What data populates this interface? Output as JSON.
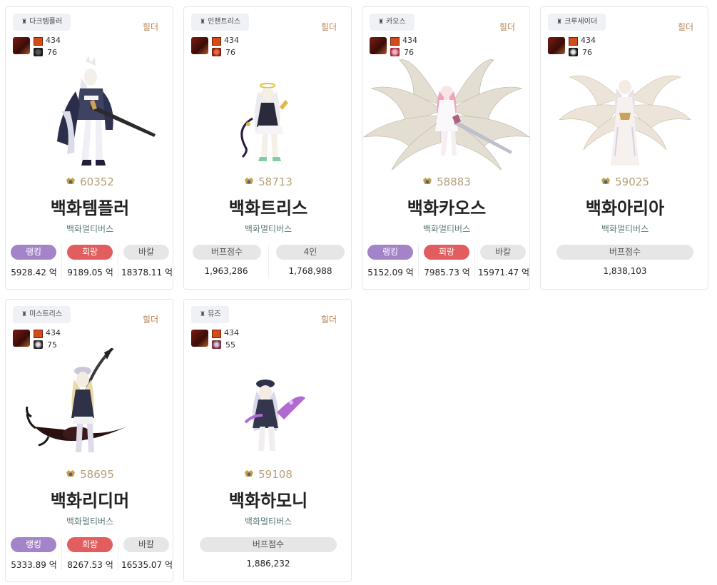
{
  "server_label": "힐더",
  "adventure_label": "백화멀티버스",
  "unit": "억",
  "colors": {
    "rank_pill": "#a384c8",
    "dmg_pill": "#e25d5d",
    "neutral_pill": "#e6e6e6",
    "fame_text": "#b5a07a",
    "server_text": "#b87f50"
  },
  "cards": [
    {
      "job": "다크템플러",
      "level": "434",
      "sub": "76",
      "fame": "60352",
      "name": "백화템플러",
      "stats": [
        {
          "label": "랭킹",
          "value": "5928.42 억"
        },
        {
          "label": "회랑",
          "value": "9189.05 억"
        },
        {
          "label": "바칼",
          "value": "18378.11 억"
        }
      ]
    },
    {
      "job": "인챈트리스",
      "level": "434",
      "sub": "76",
      "fame": "58713",
      "name": "백화트리스",
      "stats": [
        {
          "label": "버프점수",
          "value": "1,963,286"
        },
        {
          "label": "4인",
          "value": "1,768,988"
        }
      ]
    },
    {
      "job": "카오스",
      "level": "434",
      "sub": "76",
      "fame": "58883",
      "name": "백화카오스",
      "stats": [
        {
          "label": "랭킹",
          "value": "5152.09 억"
        },
        {
          "label": "회랑",
          "value": "7985.73 억"
        },
        {
          "label": "바칼",
          "value": "15971.47 억"
        }
      ]
    },
    {
      "job": "크루세이더",
      "level": "434",
      "sub": "76",
      "fame": "59025",
      "name": "백화아리아",
      "stats": [
        {
          "label": "버프점수",
          "value": "1,838,103"
        }
      ]
    },
    {
      "job": "미스트리스",
      "level": "434",
      "sub": "75",
      "fame": "58695",
      "name": "백화리디머",
      "stats": [
        {
          "label": "랭킹",
          "value": "5333.89 억"
        },
        {
          "label": "회랑",
          "value": "8267.53 억"
        },
        {
          "label": "바칼",
          "value": "16535.07 억"
        }
      ]
    },
    {
      "job": "뮤즈",
      "level": "434",
      "sub": "55",
      "fame": "59108",
      "name": "백화하모니",
      "stats": [
        {
          "label": "버프점수",
          "value": "1,886,232"
        }
      ]
    }
  ]
}
